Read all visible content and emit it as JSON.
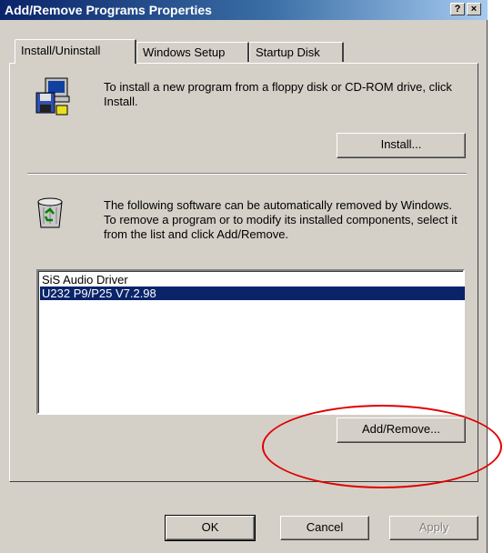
{
  "window": {
    "title": "Add/Remove Programs Properties",
    "help_button": "?",
    "close_button": "×"
  },
  "tabs": [
    {
      "label": "Install/Uninstall",
      "active": true
    },
    {
      "label": "Windows Setup",
      "active": false
    },
    {
      "label": "Startup Disk",
      "active": false
    }
  ],
  "install_section": {
    "icon": "computer-floppy-icon",
    "description": "To install a new program from a floppy disk or CD-ROM drive, click Install.",
    "install_button": "Install..."
  },
  "remove_section": {
    "icon": "recycle-bin-icon",
    "description": "The following software can be automatically removed by Windows. To remove a program or to modify its installed components, select it from the list and click Add/Remove.",
    "programs": [
      {
        "name": "SiS Audio Driver",
        "selected": false
      },
      {
        "name": "U232 P9/P25 V7.2.98",
        "selected": true
      }
    ],
    "add_remove_button": "Add/Remove..."
  },
  "footer": {
    "ok_label": "OK",
    "cancel_label": "Cancel",
    "apply_label": "Apply"
  },
  "colors": {
    "titlebar_start": "#0a246a",
    "titlebar_end": "#a6caf0",
    "selection": "#0a246a",
    "annotation": "#e00000"
  }
}
